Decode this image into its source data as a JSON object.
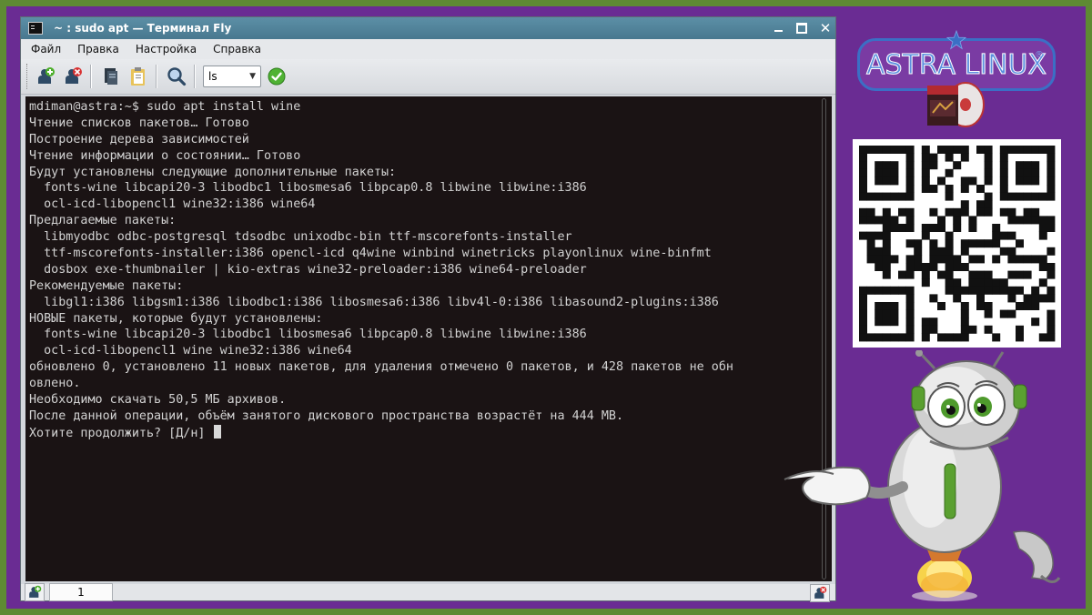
{
  "window": {
    "title": "~ : sudo apt — Терминал Fly",
    "icon": "terminal-icon"
  },
  "menu": [
    "Файл",
    "Правка",
    "Настройка",
    "Справка"
  ],
  "toolbar": {
    "command_select_value": "ls",
    "icons": [
      "new-tab-icon",
      "close-tab-icon",
      "copy-icon",
      "paste-icon",
      "search-icon",
      "run-check-icon"
    ]
  },
  "terminal": {
    "lines": [
      "mdiman@astra:~$ sudo apt install wine",
      "Чтение списков пакетов… Готово",
      "Построение дерева зависимостей",
      "Чтение информации о состоянии… Готово",
      "Будут установлены следующие дополнительные пакеты:",
      "  fonts-wine libcapi20-3 libodbc1 libosmesa6 libpcap0.8 libwine libwine:i386",
      "  ocl-icd-libopencl1 wine32:i386 wine64",
      "Предлагаемые пакеты:",
      "  libmyodbc odbc-postgresql tdsodbc unixodbc-bin ttf-mscorefonts-installer",
      "  ttf-mscorefonts-installer:i386 opencl-icd q4wine winbind winetricks playonlinux wine-binfmt",
      "  dosbox exe-thumbnailer | kio-extras wine32-preloader:i386 wine64-preloader",
      "Рекомендуемые пакеты:",
      "  libgl1:i386 libgsm1:i386 libodbc1:i386 libosmesa6:i386 libv4l-0:i386 libasound2-plugins:i386",
      "НОВЫЕ пакеты, которые будут установлены:",
      "  fonts-wine libcapi20-3 libodbc1 libosmesa6 libpcap0.8 libwine libwine:i386",
      "  ocl-icd-libopencl1 wine wine32:i386 wine64",
      "обновлено 0, установлено 11 новых пакетов, для удаления отмечено 0 пакетов, и 428 пакетов не обн",
      "овлено.",
      "Необходимо скачать 50,5 МБ архивов.",
      "После данной операции, объём занятого дискового пространства возрастёт на 444 MB.",
      "Хотите продолжить? [Д/н] "
    ]
  },
  "status": {
    "tab_label": "1"
  },
  "brand": {
    "name": "ASTRA LINUX",
    "registered": "®"
  },
  "colors": {
    "outer_frame": "#5e8a33",
    "background": "#6a2c93",
    "titlebar": "#5c8fa6",
    "terminal_bg": "#1a1314",
    "terminal_fg": "#d2d2d2",
    "logo_blue": "#3b6fc5"
  }
}
